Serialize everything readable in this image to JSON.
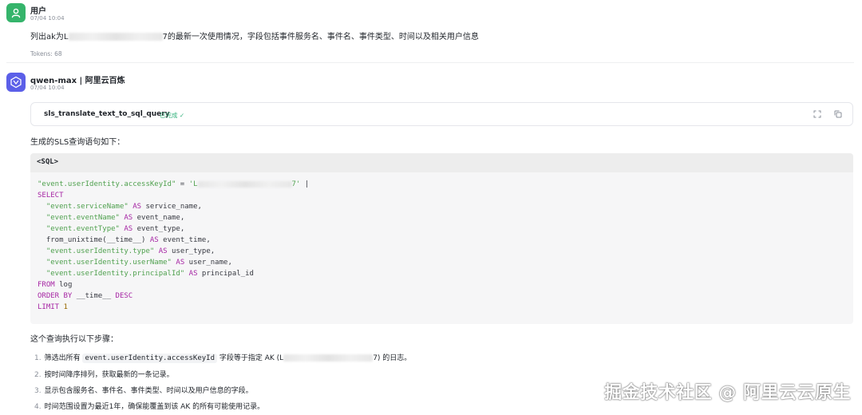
{
  "user_message": {
    "name": "用户",
    "time": "07/04 10:04",
    "text_prefix": "列出ak为L",
    "text_suffix": "7的最新一次使用情况，字段包括事件服务名、事件名、事件类型、时间以及相关用户信息",
    "tokens": "Tokens: 68"
  },
  "bot_message": {
    "name": "qwen-max | 阿里云百炼",
    "time": "07/04 10:04",
    "tool": {
      "name": "sls_translate_text_to_sql_query",
      "status": "已完成",
      "expand_icon": "expand-icon",
      "copy_icon": "copy-icon"
    },
    "intro": "生成的SLS查询语句如下：",
    "code_header": "<SQL>",
    "code_lines": {
      "l1a": "\"event.userIdentity.accessKeyId\"",
      "l1b": " = ",
      "l1c": "'L",
      "l1d": "7'",
      "l1e": " |",
      "l2": "SELECT",
      "l3a": "  \"event.serviceName\"",
      "l3b": " AS ",
      "l3c": "service_name,",
      "l4a": "  \"event.eventName\"",
      "l4b": " AS ",
      "l4c": "event_name,",
      "l5a": "  \"event.eventType\"",
      "l5b": " AS ",
      "l5c": "event_type,",
      "l6a": "  from_unixtime(__time__)",
      "l6b": " AS ",
      "l6c": "event_time,",
      "l7a": "  \"event.userIdentity.type\"",
      "l7b": " AS ",
      "l7c": "user_type,",
      "l8a": "  \"event.userIdentity.userName\"",
      "l8b": " AS ",
      "l8c": "user_name,",
      "l9a": "  \"event.userIdentity.principalId\"",
      "l9b": " AS ",
      "l9c": "principal_id",
      "l10a": "FROM",
      "l10b": " log",
      "l11a": "ORDER BY",
      "l11b": " __time__ ",
      "l11c": "DESC",
      "l12a": "LIMIT",
      "l12b": " 1"
    },
    "steps_intro": "这个查询执行以下步骤：",
    "steps": [
      {
        "idx": "1.",
        "a": "筛选出所有 ",
        "code": "event.userIdentity.accessKeyId",
        "b": " 字段等于指定 AK (L",
        "c": "7) 的日志。"
      },
      {
        "idx": "2.",
        "a": "按时间降序排列，获取最新的一条记录。"
      },
      {
        "idx": "3.",
        "a": "显示包含服务名、事件名、事件类型、时间以及用户信息的字段。"
      },
      {
        "idx": "4.",
        "a": "时间范围设置为最近1年，确保能覆盖到该 AK 的所有可能使用记录。"
      }
    ]
  },
  "watermark": "掘金技术社区 @ 阿里云云原生",
  "colors": {
    "user_avatar": "#35b46b",
    "bot_avatar": "#5b5fe8",
    "keyword": "#a626a4",
    "string": "#50a14f",
    "status": "#36b37e"
  }
}
